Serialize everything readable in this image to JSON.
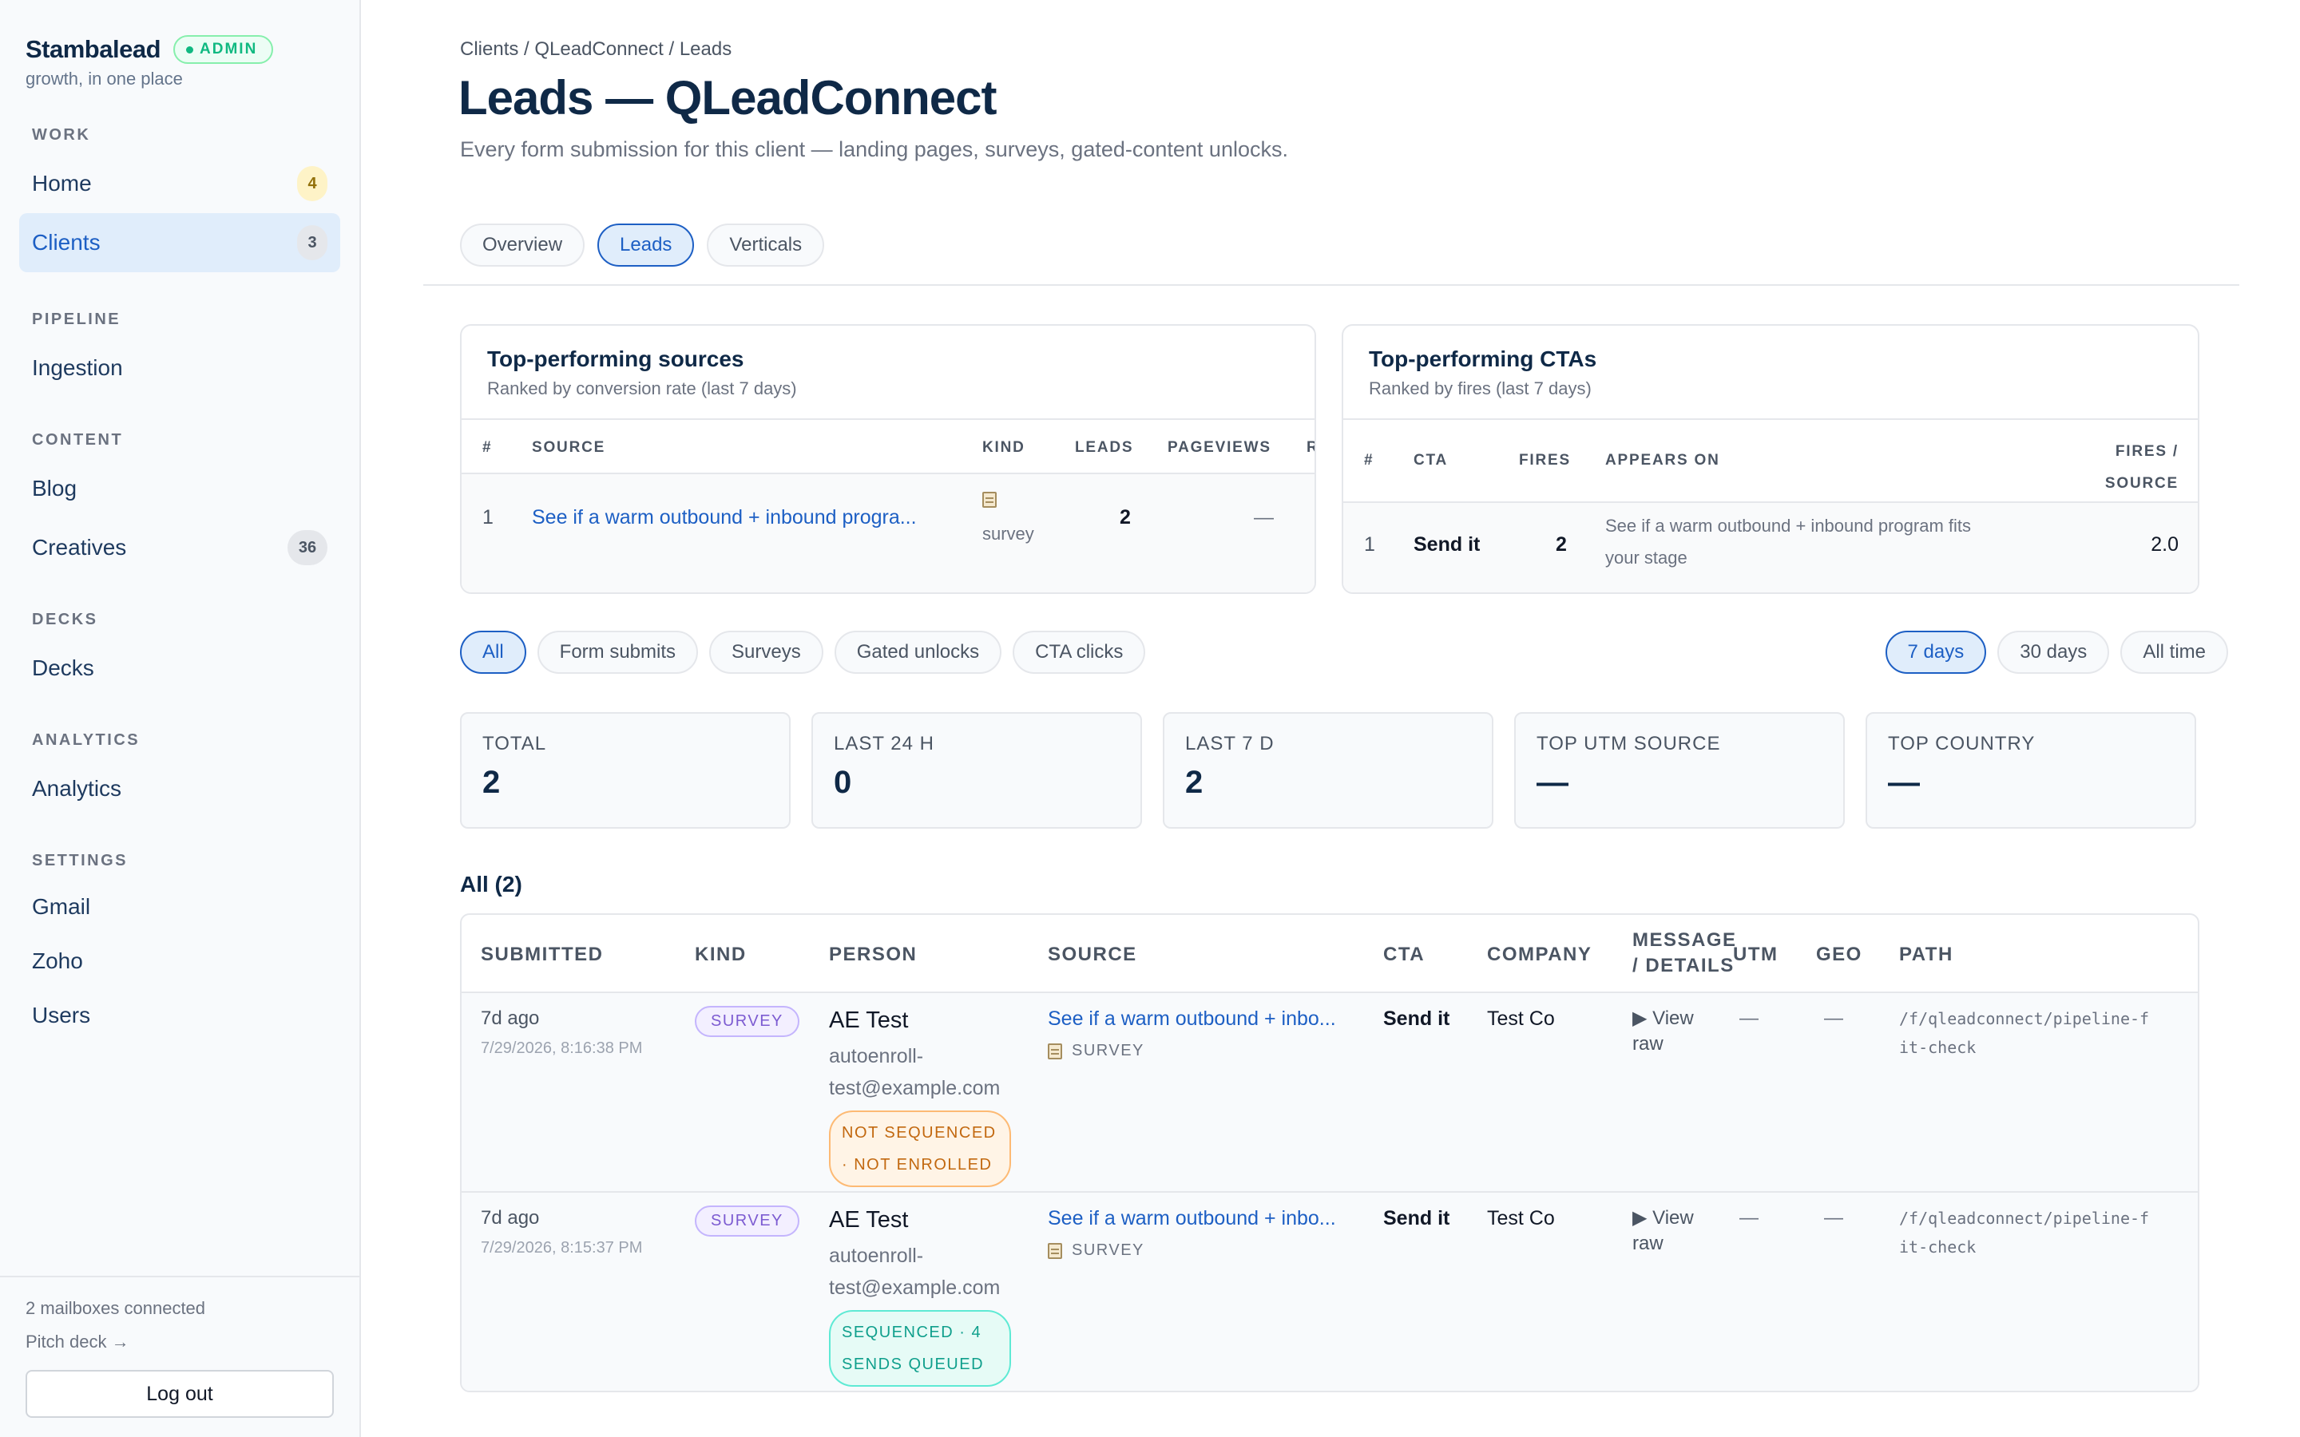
{
  "brand": {
    "name": "Stambalead",
    "badge": "ADMIN",
    "tagline": "growth, in one place"
  },
  "nav": {
    "work": {
      "title": "WORK",
      "home": "Home",
      "home_count": "4",
      "clients": "Clients",
      "clients_count": "3"
    },
    "pipeline": {
      "title": "PIPELINE",
      "ingestion": "Ingestion"
    },
    "content": {
      "title": "CONTENT",
      "blog": "Blog",
      "creatives": "Creatives",
      "creatives_count": "36"
    },
    "decks": {
      "title": "DECKS",
      "decks": "Decks"
    },
    "analytics": {
      "title": "ANALYTICS",
      "analytics": "Analytics"
    },
    "settings": {
      "title": "SETTINGS",
      "gmail": "Gmail",
      "zoho": "Zoho",
      "users": "Users"
    }
  },
  "footer": {
    "mailboxes": "2 mailboxes connected",
    "pitch": "Pitch deck →",
    "logout": "Log out"
  },
  "header": {
    "breadcrumb": "Clients / QLeadConnect / Leads",
    "title": "Leads — QLeadConnect",
    "subtitle": "Every form submission for this client — landing pages, surveys, gated-content unlocks."
  },
  "tabs": {
    "overview": "Overview",
    "leads": "Leads",
    "verticals": "Verticals"
  },
  "top_sources": {
    "title": "Top-performing sources",
    "subtitle": "Ranked by conversion rate (last 7 days)",
    "columns": {
      "num": "#",
      "source": "SOURCE",
      "kind": "KIND",
      "leads": "LEADS",
      "pageviews": "PAGEVIEWS",
      "rate": "R"
    },
    "row": {
      "num": "1",
      "source": "See if a warm outbound + inbound progra...",
      "kind": "survey",
      "leads": "2",
      "pageviews": "—"
    }
  },
  "top_ctas": {
    "title": "Top-performing CTAs",
    "subtitle": "Ranked by fires (last 7 days)",
    "columns": {
      "num": "#",
      "cta": "CTA",
      "fires": "FIRES",
      "appears": "APPEARS ON",
      "fps1": "FIRES /",
      "fps2": "SOURCE"
    },
    "row": {
      "num": "1",
      "cta": "Send it",
      "fires": "2",
      "appears1": "See if a warm outbound + inbound program fits",
      "appears2": "your stage",
      "fps": "2.0"
    }
  },
  "filters": {
    "all": "All",
    "form": "Form submits",
    "surveys": "Surveys",
    "gated": "Gated unlocks",
    "cta": "CTA clicks"
  },
  "ranges": {
    "d7": "7 days",
    "d30": "30 days",
    "all": "All time"
  },
  "stats": {
    "total": {
      "label": "TOTAL",
      "value": "2"
    },
    "last24": {
      "label": "LAST 24 H",
      "value": "0"
    },
    "last7": {
      "label": "LAST 7 D",
      "value": "2"
    },
    "utm": {
      "label": "TOP UTM SOURCE",
      "value": "—"
    },
    "country": {
      "label": "TOP COUNTRY",
      "value": "—"
    }
  },
  "list_title": "All (2)",
  "leads_table": {
    "columns": {
      "submitted": "SUBMITTED",
      "kind": "KIND",
      "person": "PERSON",
      "source": "SOURCE",
      "cta": "CTA",
      "company": "COMPANY",
      "msg1": "MESSAGE",
      "msg2": "/ DETAILS",
      "utm": "UTM",
      "geo": "GEO",
      "path": "PATH"
    },
    "rows": [
      {
        "rel": "7d ago",
        "abs": "7/29/2026, 8:16:38 PM",
        "kind": "SURVEY",
        "name": "AE Test",
        "email": "autoenroll-test@example.com",
        "status": "NOT SEQUENCED · NOT ENROLLED",
        "source": "See if a warm outbound + inbo...",
        "source_kind": "SURVEY",
        "cta": "Send it",
        "company": "Test Co",
        "message": "▶ View raw",
        "utm": "—",
        "geo": "—",
        "path": "/f/qleadconnect/pipeline-fit-check"
      },
      {
        "rel": "7d ago",
        "abs": "7/29/2026, 8:15:37 PM",
        "kind": "SURVEY",
        "name": "AE Test",
        "email": "autoenroll-test@example.com",
        "status": "SEQUENCED · 4 SENDS QUEUED",
        "source": "See if a warm outbound + inbo...",
        "source_kind": "SURVEY",
        "cta": "Send it",
        "company": "Test Co",
        "message": "▶ View raw",
        "utm": "—",
        "geo": "—",
        "path": "/f/qleadconnect/pipeline-fit-check"
      }
    ]
  }
}
